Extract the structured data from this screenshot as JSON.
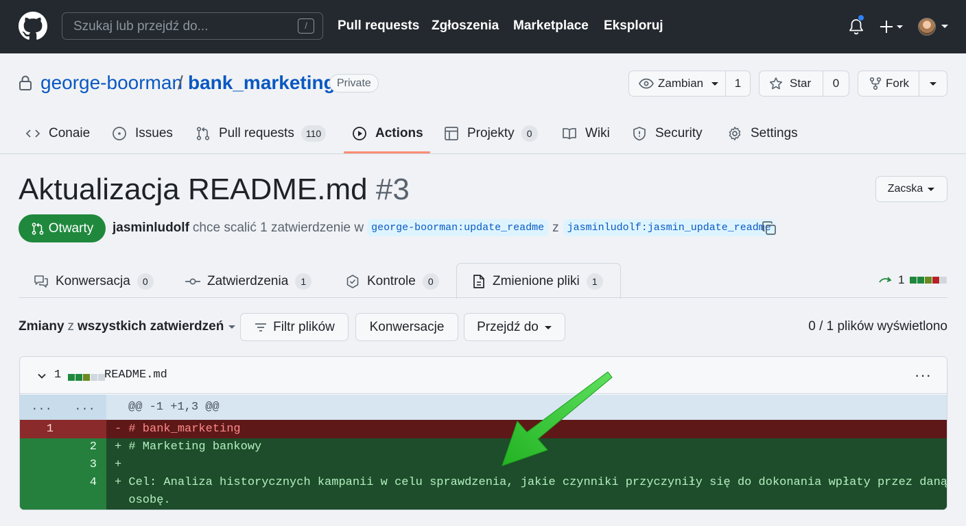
{
  "header": {
    "search_placeholder": "Szukaj lub przejdź do...",
    "search_shortcut": "/",
    "nav": [
      "Pull requests",
      "Zgłoszenia",
      "Marketplace",
      "Eksploruj"
    ]
  },
  "repo": {
    "owner": "george-boorman",
    "slash": "/",
    "name": "bank_marketing",
    "visibility": "Private",
    "watch_label": "Zambian",
    "watch_count": "1",
    "star_label": "Star",
    "star_count": "0",
    "fork_label": "Fork"
  },
  "repo_tabs": {
    "code": "Conaie",
    "issues": "Issues",
    "pulls": "Pull requests",
    "pulls_count": "110",
    "actions": "Actions",
    "projects": "Projekty",
    "projects_count": "0",
    "wiki": "Wiki",
    "security": "Security",
    "settings": "Settings"
  },
  "pr": {
    "title": "Aktualizacja README.md",
    "number": "#3",
    "code_button": "Zacska",
    "state": "Otwarty",
    "author": "jasminludolf",
    "action_text": "chce scalić 1 zatwierdzenie w",
    "base_branch": "george-boorman:update_readme",
    "from_word": "z",
    "head_branch": "jasminludolf:jasmin_update_readme"
  },
  "pr_tabs": {
    "conversation": "Konwersacja",
    "conversation_count": "0",
    "commits": "Zatwierdzenia",
    "commits_count": "1",
    "checks": "Kontrole",
    "checks_count": "0",
    "files": "Zmienione pliki",
    "files_count": "1",
    "diffstat_count": "1"
  },
  "toolbar": {
    "changes_prefix": "Zmiany",
    "changes_middle": "z",
    "changes_scope": "wszystkich zatwierdzeń",
    "filter_button": "Filtr plików",
    "conversations_button": "Konwersacje",
    "jump_button": "Przejdź do",
    "viewed_status": "0 / 1 plików wyświetlono"
  },
  "file": {
    "change_count": "1",
    "name": "README.md",
    "more_menu": "···",
    "hunk_left": "...",
    "hunk_right": "...",
    "hunk_header": "@@ -1 +1,3 @@",
    "lines": [
      {
        "type": "del",
        "old": "1",
        "new": "",
        "text": "- # bank_marketing"
      },
      {
        "type": "add",
        "old": "",
        "new": "2",
        "text": "+ # Marketing bankowy"
      },
      {
        "type": "add",
        "old": "",
        "new": "3",
        "text": "+"
      },
      {
        "type": "add",
        "old": "",
        "new": "4",
        "text": "+ Cel: Analiza historycznych kampanii w celu sprawdzenia, jakie czynniki przyczyniły się do dokonania wpłaty przez daną"
      },
      {
        "type": "add",
        "old": "",
        "new": "",
        "text": "  osobę."
      }
    ]
  },
  "colors": {
    "accent_green": "#1f883d",
    "annotation_arrow": "#2ecc2e",
    "tab_underline": "#fd8c73"
  }
}
